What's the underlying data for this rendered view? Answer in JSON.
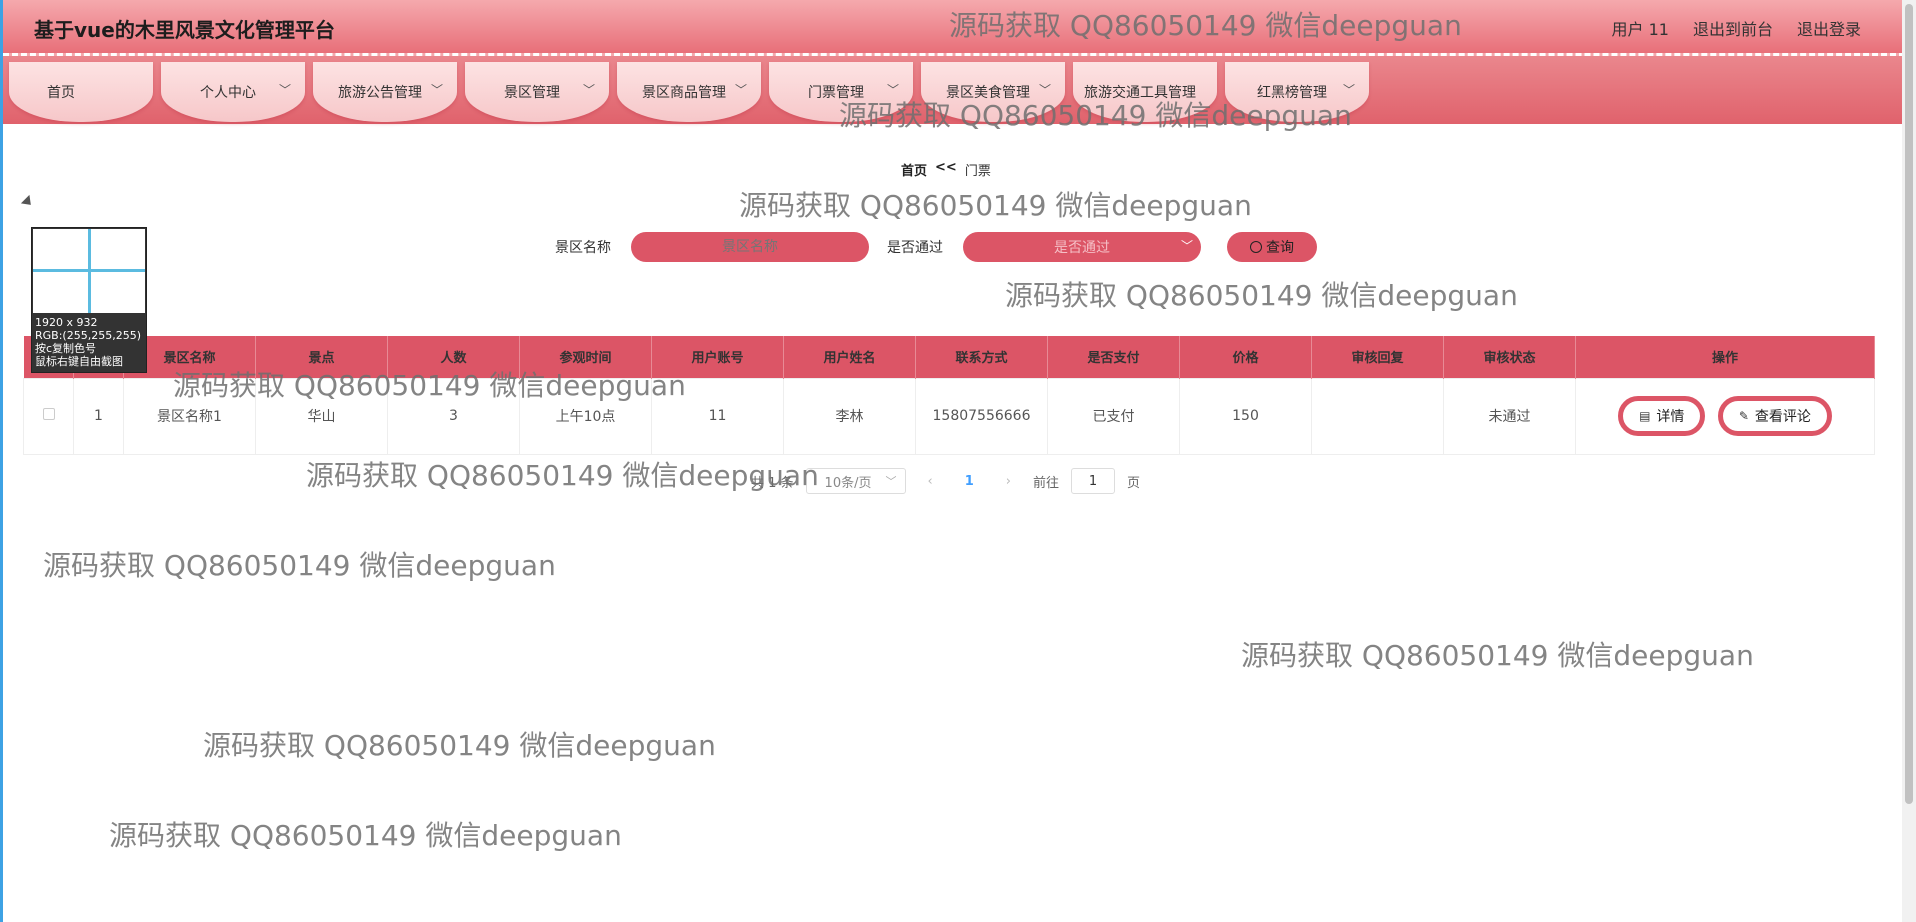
{
  "header": {
    "title": "基于vue的木里风景文化管理平台",
    "user_label": "用户 11",
    "back_label": "退出到前台",
    "logout_label": "退出登录"
  },
  "nav": {
    "items": [
      {
        "label": "首页",
        "has_dropdown": false
      },
      {
        "label": "个人中心",
        "has_dropdown": true
      },
      {
        "label": "旅游公告管理",
        "has_dropdown": true
      },
      {
        "label": "景区管理",
        "has_dropdown": true
      },
      {
        "label": "景区商品管理",
        "has_dropdown": true
      },
      {
        "label": "门票管理",
        "has_dropdown": true
      },
      {
        "label": "景区美食管理",
        "has_dropdown": true
      },
      {
        "label": "旅游交通工具管理",
        "has_dropdown": false
      },
      {
        "label": "红黑榜管理",
        "has_dropdown": true
      }
    ]
  },
  "breadcrumb": {
    "home": "首页",
    "sep": "<<",
    "current": "门票"
  },
  "search": {
    "name_label": "景区名称",
    "name_placeholder": "景区名称",
    "pass_label": "是否通过",
    "pass_placeholder": "是否通过",
    "button_label": "查询"
  },
  "table": {
    "columns": [
      "",
      "",
      "景区名称",
      "景点",
      "人数",
      "参观时间",
      "用户账号",
      "用户姓名",
      "联系方式",
      "是否支付",
      "价格",
      "审核回复",
      "审核状态",
      "操作"
    ],
    "rows": [
      {
        "index": "1",
        "scenic_name": "景区名称1",
        "spot": "华山",
        "people": "3",
        "visit_time": "上午10点",
        "account": "11",
        "user_name": "李林",
        "phone": "15807556666",
        "paid": "已支付",
        "price": "150",
        "reply": "",
        "status": "未通过",
        "detail_label": "详情",
        "comment_label": "查看评论"
      }
    ]
  },
  "pagination": {
    "total_text": "共 1 条",
    "page_size": "10条/页",
    "current_page": "1",
    "goto_label": "前往",
    "goto_value": "1",
    "page_unit": "页"
  },
  "magnifier": {
    "size": "1920 x 932",
    "rgb": "RGB:(255,255,255)",
    "hint1": "按c复制色号",
    "hint2": "鼠标右键自由截图"
  },
  "watermark": "源码获取 QQ86050149 微信deepguan",
  "colors": {
    "accent": "#dc5566",
    "header_top": "#f5a9ad",
    "page_link": "#409eff"
  }
}
